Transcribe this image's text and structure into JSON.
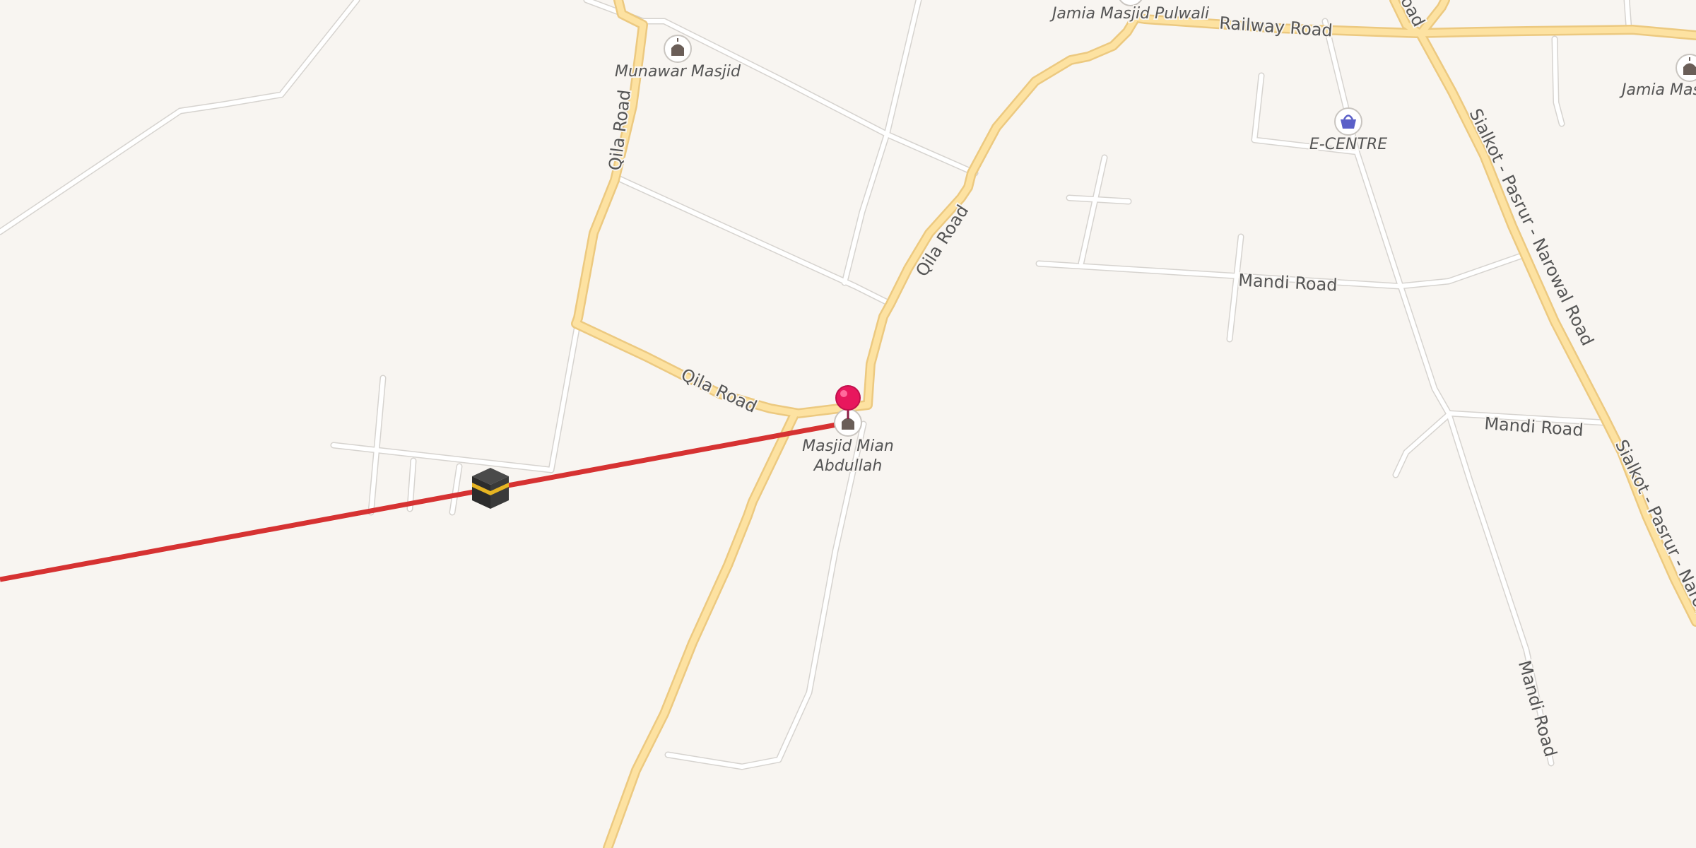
{
  "map": {
    "colors": {
      "background": "#f8f5f1",
      "main_road": "#fde2a1",
      "minor_road": "#ffffff",
      "qibla_line": "#d63232",
      "pin": "#e8175d"
    },
    "road_labels": {
      "qila_road_north": "Qila Road",
      "qila_road_mid": "Qila Road",
      "qila_road_east": "Qila Road",
      "railway_road": "Railway Road",
      "road_top_fragment": "oad",
      "mandi_road_1": "Mandi Road",
      "mandi_road_2": "Mandi Road",
      "mandi_road_3": "Mandi Road",
      "sialkot_road_1": "Sialkot - Pasrur - Narowal Road",
      "sialkot_road_2": "Sialkot - Pasrur - Narowa"
    },
    "places": {
      "munawar_masjid": {
        "name": "Munawar Masjid",
        "icon": "mosque-icon"
      },
      "jamia_masjid_pulwali": {
        "name": "Jamia Masjid Pulwali",
        "icon": "mosque-icon"
      },
      "jamia_mas": {
        "name": "Jamia Mas",
        "icon": "mosque-icon"
      },
      "e_centre": {
        "name": "E-CENTRE",
        "icon": "shopping-basket-icon"
      },
      "masjid_mian_abdullah": {
        "name_line1": "Masjid Mian",
        "name_line2": "Abdullah",
        "icon": "mosque-icon"
      }
    },
    "markers": {
      "location_pin": {
        "icon": "location-pin-icon"
      },
      "qibla_direction": {
        "icon": "kaaba-icon"
      }
    }
  }
}
